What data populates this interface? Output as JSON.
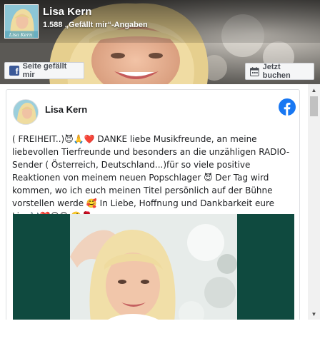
{
  "header": {
    "page_name": "Lisa Kern",
    "likes_text": "1.588 „Gefällt mir“-Angaben",
    "like_button_label": "Seite gefällt mir",
    "book_button_label": "Jetzt buchen",
    "thumb_caption": "Lisa Kern"
  },
  "post": {
    "author": "Lisa Kern",
    "text": "( FREIHEIT..)😈🙏❤️ DANKE liebe Musikfreunde, an meine liebevollen Tierfreunde und besonders an die unzähligen RADIO-Sender ( Österreich, Deutschland...)für so viele positive Reaktionen von meinem neuen Popschlager 😈 Der Tag wird kommen, wo ich euch meinen Titel persönlich auf der Bühne vorstellen werde 🥰 In Liebe, Hoffnung und Dankbarkeit eure Lisa🎶❤️😘😊 🤗🌹"
  },
  "colors": {
    "facebook_blue": "#1877f2",
    "button_bg": "#f5f6f7",
    "image_bg": "#0f4a3f"
  },
  "icons": {
    "like_button_icon": "facebook-f-square-icon",
    "book_button_icon": "calendar-icon",
    "post_brand_icon": "facebook-logo-icon",
    "scroll_up": "triangle-up-icon",
    "scroll_down": "triangle-down-icon"
  }
}
